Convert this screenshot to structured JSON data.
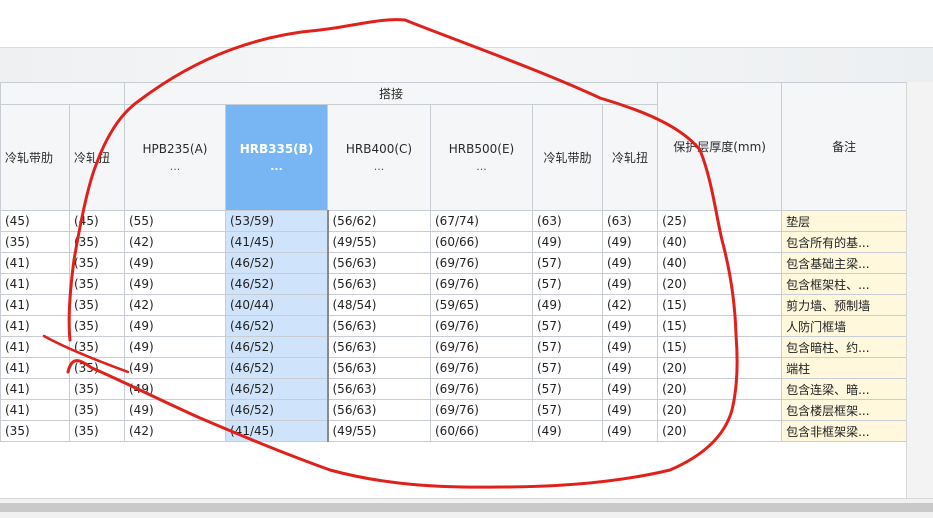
{
  "header": {
    "group_lap": "搭接"
  },
  "columns": [
    {
      "label": "冷轧带肋",
      "sub": ""
    },
    {
      "label": "冷轧扭",
      "sub": ""
    },
    {
      "label": "HPB235(A)",
      "sub": "..."
    },
    {
      "label": "HRB335(B)",
      "sub": "..."
    },
    {
      "label": "HRB400(C)",
      "sub": "..."
    },
    {
      "label": "HRB500(E)",
      "sub": "..."
    },
    {
      "label": "冷轧带肋",
      "sub": ""
    },
    {
      "label": "冷轧扭",
      "sub": ""
    },
    {
      "label": "保护层厚度(mm)",
      "sub": ""
    },
    {
      "label": "备注",
      "sub": ""
    }
  ],
  "rows": [
    [
      "(45)",
      "(45)",
      "(55)",
      "(53/59)",
      "(56/62)",
      "(67/74)",
      "(63)",
      "(63)",
      "(25)",
      "垫层"
    ],
    [
      "(35)",
      "(35)",
      "(42)",
      "(41/45)",
      "(49/55)",
      "(60/66)",
      "(49)",
      "(49)",
      "(40)",
      "包含所有的基..."
    ],
    [
      "(41)",
      "(35)",
      "(49)",
      "(46/52)",
      "(56/63)",
      "(69/76)",
      "(57)",
      "(49)",
      "(40)",
      "包含基础主梁..."
    ],
    [
      "(41)",
      "(35)",
      "(49)",
      "(46/52)",
      "(56/63)",
      "(69/76)",
      "(57)",
      "(49)",
      "(20)",
      "包含框架柱、..."
    ],
    [
      "(41)",
      "(35)",
      "(42)",
      "(40/44)",
      "(48/54)",
      "(59/65)",
      "(49)",
      "(42)",
      "(15)",
      "剪力墙、预制墙"
    ],
    [
      "(41)",
      "(35)",
      "(49)",
      "(46/52)",
      "(56/63)",
      "(69/76)",
      "(57)",
      "(49)",
      "(15)",
      "人防门框墙"
    ],
    [
      "(41)",
      "(35)",
      "(49)",
      "(46/52)",
      "(56/63)",
      "(69/76)",
      "(57)",
      "(49)",
      "(15)",
      "包含暗柱、约..."
    ],
    [
      "(41)",
      "(35)",
      "(49)",
      "(46/52)",
      "(56/63)",
      "(69/76)",
      "(57)",
      "(49)",
      "(20)",
      "端柱"
    ],
    [
      "(41)",
      "(35)",
      "(49)",
      "(46/52)",
      "(56/63)",
      "(69/76)",
      "(57)",
      "(49)",
      "(20)",
      "包含连梁、暗..."
    ],
    [
      "(41)",
      "(35)",
      "(49)",
      "(46/52)",
      "(56/63)",
      "(69/76)",
      "(57)",
      "(49)",
      "(20)",
      "包含楼层框架..."
    ],
    [
      "(35)",
      "(35)",
      "(42)",
      "(41/45)",
      "(49/55)",
      "(60/66)",
      "(49)",
      "(49)",
      "(20)",
      "包含非框架梁..."
    ]
  ],
  "colors": {
    "lap_header": "#5aa9ea",
    "selected_header": "#77b6f2",
    "selected_column": "#cfe4fb",
    "note_column": "#fff8dc",
    "annotation": "#e0201a"
  }
}
